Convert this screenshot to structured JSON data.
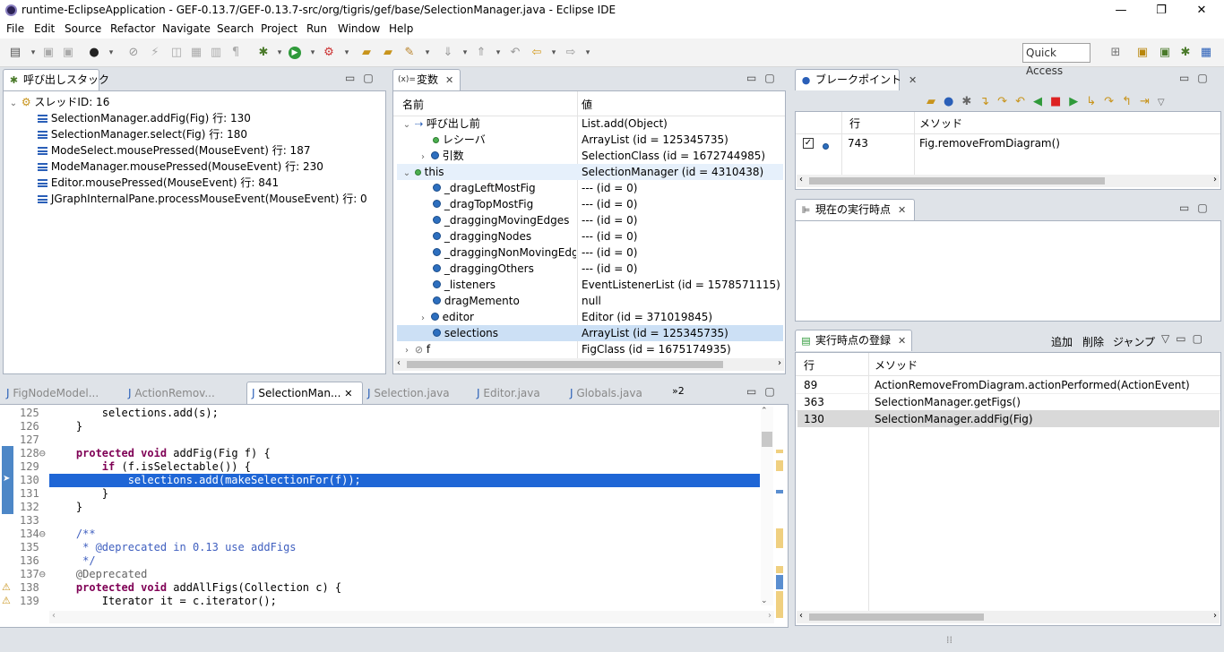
{
  "window": {
    "title": "runtime-EclipseApplication - GEF-0.13.7/GEF-0.13.7-src/org/tigris/gef/base/SelectionManager.java - Eclipse IDE",
    "minimize": "—",
    "restore": "❐",
    "close": "✕"
  },
  "menu": [
    "File",
    "Edit",
    "Source",
    "Refactor",
    "Navigate",
    "Search",
    "Project",
    "Run",
    "Window",
    "Help"
  ],
  "quick_access": "Quick Access",
  "callstack": {
    "tab": "呼び出しスタック",
    "thread": "スレッドID: 16",
    "frames": [
      "SelectionManager.addFig(Fig) 行: 130",
      "SelectionManager.select(Fig) 行: 180",
      "ModeSelect.mousePressed(MouseEvent) 行: 187",
      "ModeManager.mousePressed(MouseEvent) 行: 230",
      "Editor.mousePressed(MouseEvent) 行: 841",
      "JGraphInternalPane.processMouseEvent(MouseEvent) 行: 0"
    ]
  },
  "variables": {
    "tab": "変数",
    "col_name": "名前",
    "col_value": "値",
    "rows": [
      {
        "name": "呼び出し前",
        "value": "List.add(Object)"
      },
      {
        "name": "レシーバ",
        "value": "ArrayList (id = 125345735)"
      },
      {
        "name": "引数",
        "value": "SelectionClass (id = 1672744985)"
      },
      {
        "name": "this",
        "value": "SelectionManager (id = 4310438)"
      },
      {
        "name": "_dragLeftMostFig",
        "value": "--- (id = 0)"
      },
      {
        "name": "_dragTopMostFig",
        "value": "--- (id = 0)"
      },
      {
        "name": "_draggingMovingEdges",
        "value": "--- (id = 0)"
      },
      {
        "name": "_draggingNodes",
        "value": "--- (id = 0)"
      },
      {
        "name": "_draggingNonMovingEdges",
        "value": "--- (id = 0)"
      },
      {
        "name": "_draggingOthers",
        "value": "--- (id = 0)"
      },
      {
        "name": "_listeners",
        "value": "EventListenerList (id = 1578571115)"
      },
      {
        "name": "dragMemento",
        "value": "null"
      },
      {
        "name": "editor",
        "value": "Editor (id = 371019845)"
      },
      {
        "name": "selections",
        "value": "ArrayList (id = 125345735)"
      },
      {
        "name": "f",
        "value": "FigClass (id = 1675174935)"
      }
    ]
  },
  "breakpoints": {
    "tab": "ブレークポイント",
    "col_line": "行",
    "col_method": "メソッド",
    "line": "743",
    "method": "Fig.removeFromDiagram()"
  },
  "current": {
    "tab": "現在の実行時点"
  },
  "register": {
    "tab": "実行時点の登録",
    "add": "追加",
    "delete": "削除",
    "jump": "ジャンプ",
    "col_line": "行",
    "col_method": "メソッド",
    "rows": [
      {
        "line": "89",
        "method": "ActionRemoveFromDiagram.actionPerformed(ActionEvent)"
      },
      {
        "line": "363",
        "method": "SelectionManager.getFigs()"
      },
      {
        "line": "130",
        "method": "SelectionManager.addFig(Fig)"
      }
    ]
  },
  "editor": {
    "tabs": [
      "FigNodeModel...",
      "ActionRemov...",
      "SelectionMan...",
      "Selection.java",
      "Editor.java",
      "Globals.java"
    ],
    "overflow": "»2",
    "lines": [
      {
        "n": "125",
        "t": "        selections.add(s);"
      },
      {
        "n": "126",
        "t": "    }"
      },
      {
        "n": "127",
        "t": ""
      },
      {
        "n": "128⊖",
        "t": "    protected void addFig(Fig f) {"
      },
      {
        "n": "129",
        "t": "        if (f.isSelectable()) {"
      },
      {
        "n": "130",
        "t": "            selections.add(makeSelectionFor(f));"
      },
      {
        "n": "131",
        "t": "        }"
      },
      {
        "n": "132",
        "t": "    }"
      },
      {
        "n": "133",
        "t": ""
      },
      {
        "n": "134⊖",
        "t": "    /**"
      },
      {
        "n": "135",
        "t": "     * @deprecated in 0.13 use addFigs"
      },
      {
        "n": "136",
        "t": "     */"
      },
      {
        "n": "137⊖",
        "t": "    @Deprecated"
      },
      {
        "n": "138",
        "t": "    protected void addAllFigs(Collection c) {"
      },
      {
        "n": "139",
        "t": "        Iterator it = c.iterator();"
      }
    ]
  }
}
